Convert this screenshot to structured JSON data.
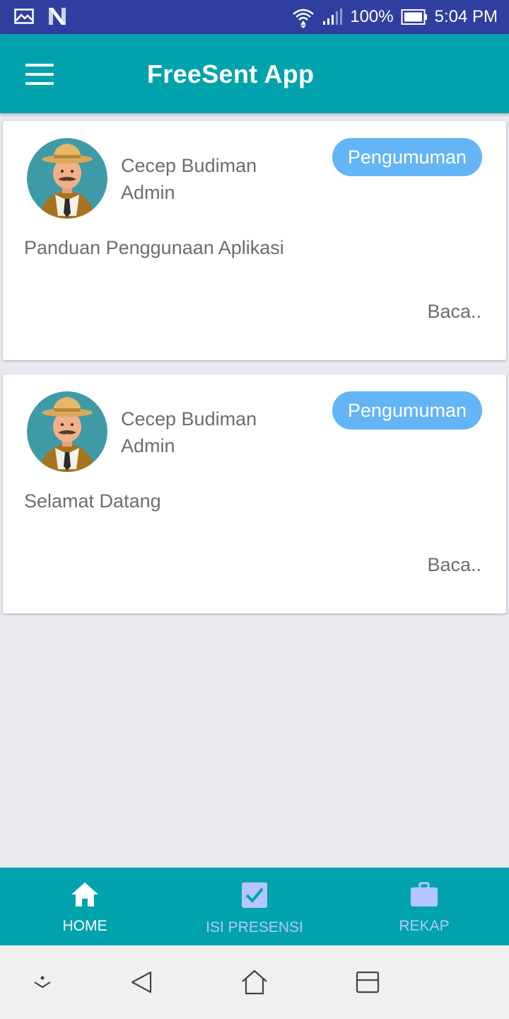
{
  "status_bar": {
    "battery": "100%",
    "time": "5:04 PM",
    "icons": [
      "image-icon",
      "n-notification-icon",
      "wifi-icon",
      "signal-icon",
      "battery-icon"
    ]
  },
  "app_bar": {
    "title": "FreeSent App",
    "menu_icon": "hamburger-menu-icon"
  },
  "posts": [
    {
      "author_name": "Cecep Budiman",
      "author_role": "Admin",
      "badge": "Pengumuman",
      "title": "Panduan Penggunaan Aplikasi",
      "read_more": "Baca.."
    },
    {
      "author_name": "Cecep Budiman",
      "author_role": "Admin",
      "badge": "Pengumuman",
      "title": "Selamat Datang",
      "read_more": "Baca.."
    }
  ],
  "bottom_nav": {
    "items": [
      {
        "label": "HOME",
        "icon": "home-icon",
        "active": true
      },
      {
        "label": "ISI PRESENSI",
        "icon": "checkbox-icon",
        "active": false
      },
      {
        "label": "REKAP",
        "icon": "briefcase-icon",
        "active": false
      }
    ]
  },
  "system_nav": {
    "icons": [
      "hide-keyboard-icon",
      "back-icon",
      "home-icon",
      "recents-icon"
    ]
  },
  "colors": {
    "status_bar": "#303f9f",
    "primary": "#00a3ad",
    "badge": "#64b5f6",
    "background": "#e8e8ee",
    "inactive_nav": "#b4c6ff"
  }
}
